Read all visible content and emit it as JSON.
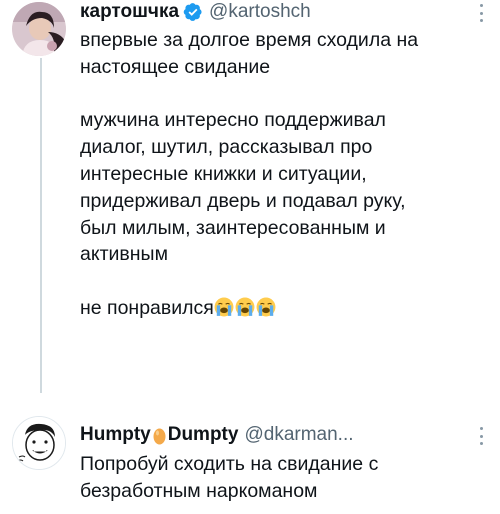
{
  "tweet": {
    "author_name": "картошчка",
    "author_handle": "@kartoshch",
    "verified": true,
    "lines": [
      "впервые за долгое время сходила на",
      "настоящее свидание",
      "",
      "мужчина интересно поддерживал",
      "диалог, шутил, рассказывал про",
      "интересные книжки и ситуации,",
      "придерживал дверь и подавал руку,",
      "был милым, заинтересованным и",
      "активным",
      ""
    ],
    "last_line": "не понравился",
    "last_line_emoji": [
      "loudly-crying-face",
      "loudly-crying-face",
      "loudly-crying-face"
    ]
  },
  "reply": {
    "author_name_part1": "Humpty",
    "author_name_emoji": "egg",
    "author_name_part2": "Dumpty",
    "author_handle": "@dkarman...",
    "lines": [
      "Попробуй сходить на свидание с",
      "безработным наркоманом"
    ]
  },
  "colors": {
    "text": "#0f1419",
    "secondary": "#536471",
    "verified_blue": "#1d9bf0",
    "thread_line": "#cfd9de"
  }
}
